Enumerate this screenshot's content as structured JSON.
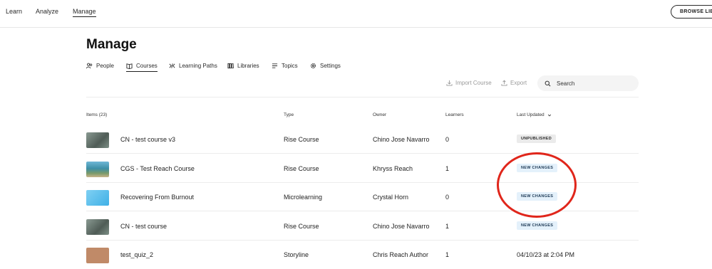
{
  "topnav": {
    "links": [
      "Learn",
      "Analyze",
      "Manage"
    ],
    "browse_label": "BROWSE LIBRARY"
  },
  "page": {
    "title": "Manage"
  },
  "subtabs": [
    "People",
    "Courses",
    "Learning Paths",
    "Libraries",
    "Topics",
    "Settings"
  ],
  "toolbar": {
    "import_label": "Import Course",
    "export_label": "Export",
    "search_placeholder": "Search"
  },
  "table": {
    "headers": {
      "items": "Items (23)",
      "type": "Type",
      "owner": "Owner",
      "learners": "Learners",
      "last_updated": "Last Updated"
    },
    "rows": [
      {
        "title": "CN - test course v3",
        "type": "Rise Course",
        "owner": "Chino Jose Navarro",
        "learners": "0",
        "status": "UNPUBLISHED",
        "thumb_color": "#6b7a74"
      },
      {
        "title": "CGS - Test Reach Course",
        "type": "Rise Course",
        "owner": "Khryss Reach",
        "learners": "1",
        "status": "NEW CHANGES",
        "thumb_color": "#4a9db0"
      },
      {
        "title": "Recovering From Burnout",
        "type": "Microlearning",
        "owner": "Crystal Horn",
        "learners": "0",
        "status": "NEW CHANGES",
        "thumb_color": "#4fb9e8"
      },
      {
        "title": "CN - test course",
        "type": "Rise Course",
        "owner": "Chino Jose Navarro",
        "learners": "1",
        "status": "NEW CHANGES",
        "thumb_color": "#6b7a74"
      },
      {
        "title": "test_quiz_2",
        "type": "Storyline",
        "owner": "Chris Reach Author",
        "learners": "1",
        "status": "04/10/23 at 2:04 PM",
        "thumb_color": "#c08a68"
      }
    ]
  },
  "colors": {
    "annotation": "#e0261b",
    "badge_new": "#e4f1fb",
    "badge_unpublished": "#ebebeb"
  }
}
